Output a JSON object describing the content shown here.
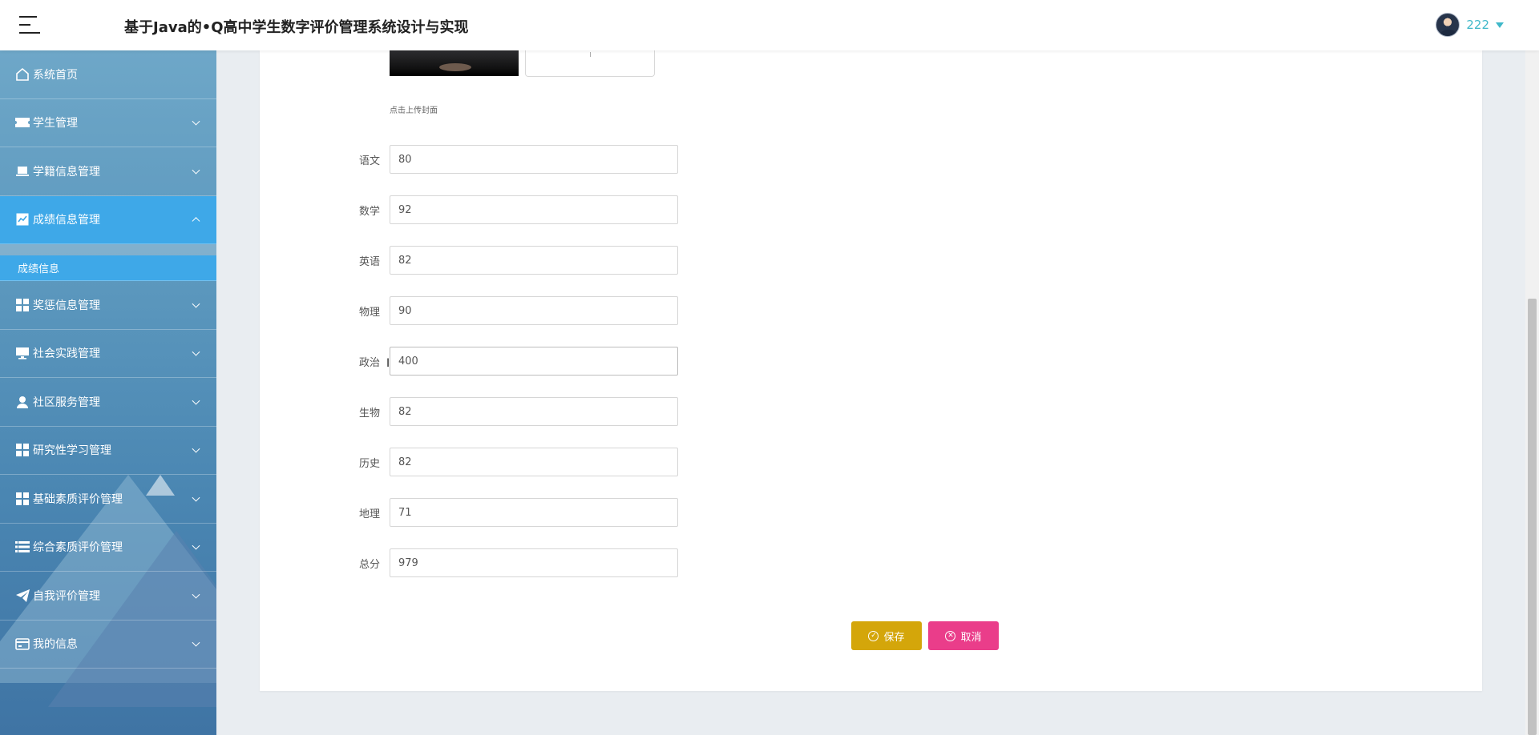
{
  "header": {
    "title": "基于Java的•Q高中学生数字评价管理系统设计与实现",
    "user_name": "222"
  },
  "sidebar": {
    "items": [
      {
        "label": "系统首页",
        "icon": "home-icon"
      },
      {
        "label": "学生管理",
        "icon": "ticket-icon"
      },
      {
        "label": "学籍信息管理",
        "icon": "laptop-icon"
      },
      {
        "label": "成绩信息管理",
        "icon": "chart-icon",
        "active": true
      },
      {
        "label": "奖惩信息管理",
        "icon": "grid-icon"
      },
      {
        "label": "社会实践管理",
        "icon": "monitor-icon"
      },
      {
        "label": "社区服务管理",
        "icon": "user-icon"
      },
      {
        "label": "研究性学习管理",
        "icon": "grid-icon"
      },
      {
        "label": "基础素质评价管理",
        "icon": "grid-icon"
      },
      {
        "label": "综合素质评价管理",
        "icon": "list-icon"
      },
      {
        "label": "自我评价管理",
        "icon": "paper-plane-icon"
      },
      {
        "label": "我的信息",
        "icon": "wallet-icon"
      }
    ],
    "sub_item": "成绩信息"
  },
  "form": {
    "upload_hint": "点击上传封面",
    "fields": [
      {
        "label": "语文",
        "value": "80"
      },
      {
        "label": "数学",
        "value": "92"
      },
      {
        "label": "英语",
        "value": "82"
      },
      {
        "label": "物理",
        "value": "90"
      },
      {
        "label": "政治",
        "value": "400"
      },
      {
        "label": "生物",
        "value": "82"
      },
      {
        "label": "历史",
        "value": "82"
      },
      {
        "label": "地理",
        "value": "71"
      },
      {
        "label": "总分",
        "value": "979"
      }
    ],
    "save_label": "保存",
    "cancel_label": "取消"
  },
  "colors": {
    "sidebar_active": "#3ea8e8",
    "save_button": "#d4a60a",
    "cancel_button": "#ea3d8a",
    "user_name": "#3fb8c9"
  }
}
